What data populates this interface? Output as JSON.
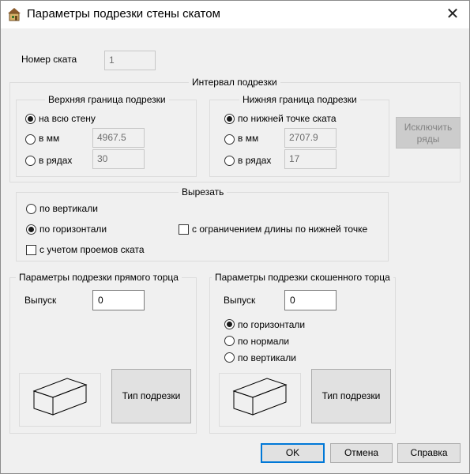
{
  "window": {
    "title": "Параметры подрезки стены скатом",
    "close_glyph": "✕",
    "app_icon": "house-icon"
  },
  "slope_number": {
    "label": "Номер ската",
    "value": "1"
  },
  "cut_interval": {
    "title": "Интервал подрезки",
    "upper": {
      "title": "Верхняя граница подрезки",
      "options": [
        "на всю стену",
        "в мм",
        "в рядах"
      ],
      "selected": 0,
      "mm_value": "4967.5",
      "rows_value": "30"
    },
    "lower": {
      "title": "Нижняя граница подрезки",
      "options": [
        "по нижней точке ската",
        "в мм",
        "в рядах"
      ],
      "selected": 0,
      "mm_value": "2707.9",
      "rows_value": "17"
    },
    "exclude_rows_button": "Исключить ряды"
  },
  "cut_out": {
    "title": "Вырезать",
    "vertical": "по вертикали",
    "horizontal": "по горизонтали",
    "selected": "horizontal",
    "limit_length": {
      "label": "с ограничением длины по нижней точке",
      "checked": false
    },
    "consider_openings": {
      "label": "с учетом проемов ската",
      "checked": false
    }
  },
  "straight_end": {
    "title": "Параметры подрезки прямого торца",
    "overhang_label": "Выпуск",
    "overhang_value": "0",
    "cut_type_button": "Тип подрезки"
  },
  "beveled_end": {
    "title": "Параметры подрезки скошенного торца",
    "overhang_label": "Выпуск",
    "overhang_value": "0",
    "options": [
      "по горизонтали",
      "по нормали",
      "по вертикали"
    ],
    "selected": 0,
    "cut_type_button": "Тип подрезки"
  },
  "footer": {
    "ok": "OK",
    "cancel": "Отмена",
    "help": "Справка"
  },
  "colors": {
    "accent": "#0078d7",
    "background": "#f0f0f0",
    "titlebar": "#ffffff"
  }
}
